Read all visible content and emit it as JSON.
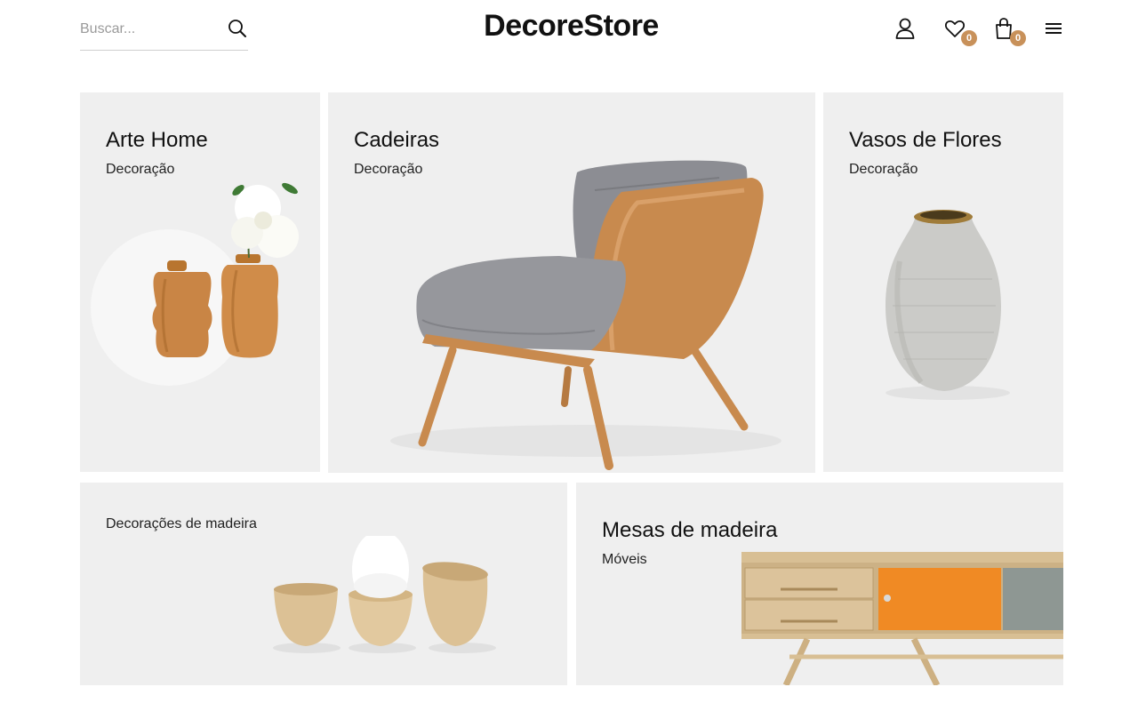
{
  "header": {
    "search_placeholder": "Buscar...",
    "logo": "DecoreStore",
    "wishlist_count": "0",
    "cart_count": "0"
  },
  "colors": {
    "badge": "#c8915a",
    "tile_bg": "#efefef",
    "text": "#111111"
  },
  "icons": {
    "search": "search-icon",
    "user": "user-icon",
    "wishlist": "heart-icon",
    "cart": "bag-icon",
    "menu": "hamburger-menu-icon"
  },
  "categories": [
    {
      "title": "Arte Home",
      "subtitle": "Decoração"
    },
    {
      "title": "Cadeiras",
      "subtitle": "Decoração"
    },
    {
      "title": "Vasos de Flores",
      "subtitle": "Decoração"
    },
    {
      "title": "",
      "subtitle": "Decorações de madeira"
    },
    {
      "title": "Mesas de madeira",
      "subtitle": "Móveis"
    }
  ]
}
